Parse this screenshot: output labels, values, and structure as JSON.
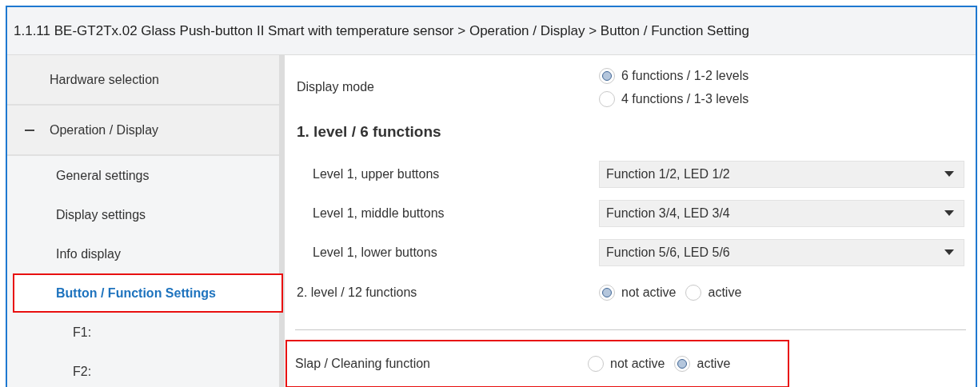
{
  "window": {
    "title": "1.1.11 BE-GT2Tx.02 Glass Push-button II Smart with temperature sensor > Operation / Display > Button / Function Setting"
  },
  "sidebar": {
    "items": [
      {
        "label": "Hardware selection",
        "selected": false,
        "highlighted": false
      },
      {
        "label": "Operation / Display",
        "selected": false,
        "highlighted": false,
        "expanded": true,
        "children": [
          {
            "label": "General settings",
            "selected": false,
            "highlighted": false
          },
          {
            "label": "Display settings",
            "selected": false,
            "highlighted": false
          },
          {
            "label": "Info display",
            "selected": false,
            "highlighted": false
          },
          {
            "label": "Button / Function Settings",
            "selected": true,
            "highlighted": true,
            "children": [
              {
                "label": "F1:",
                "selected": false,
                "highlighted": false
              },
              {
                "label": "F2:",
                "selected": false,
                "highlighted": false
              }
            ]
          }
        ]
      }
    ]
  },
  "parameters": [
    {
      "kind": "radio_stack",
      "label": "Display mode",
      "highlighted": false,
      "options": [
        {
          "label": "6 functions / 1-2 levels",
          "selected": true
        },
        {
          "label": "4 functions / 1-3 levels",
          "selected": false
        }
      ]
    },
    {
      "kind": "heading",
      "label": "1. level / 6 functions",
      "highlighted": false
    },
    {
      "kind": "dropdown",
      "label": "Level 1, upper buttons",
      "highlighted": false,
      "value": "Function 1/2, LED 1/2"
    },
    {
      "kind": "dropdown",
      "label": "Level 1, middle buttons",
      "highlighted": false,
      "value": "Function 3/4, LED 3/4"
    },
    {
      "kind": "dropdown",
      "label": "Level 1, lower buttons",
      "highlighted": false,
      "value": "Function 5/6, LED 5/6"
    },
    {
      "kind": "radio_inline",
      "label": "2. level / 12 functions",
      "highlighted": false,
      "options": [
        {
          "label": "not active",
          "selected": true
        },
        {
          "label": "active",
          "selected": false
        }
      ]
    },
    {
      "kind": "divider",
      "highlighted": false
    },
    {
      "kind": "radio_inline",
      "label": "Slap / Cleaning function",
      "highlighted": true,
      "options": [
        {
          "label": "not active",
          "selected": false
        },
        {
          "label": "active",
          "selected": true
        }
      ]
    }
  ]
}
